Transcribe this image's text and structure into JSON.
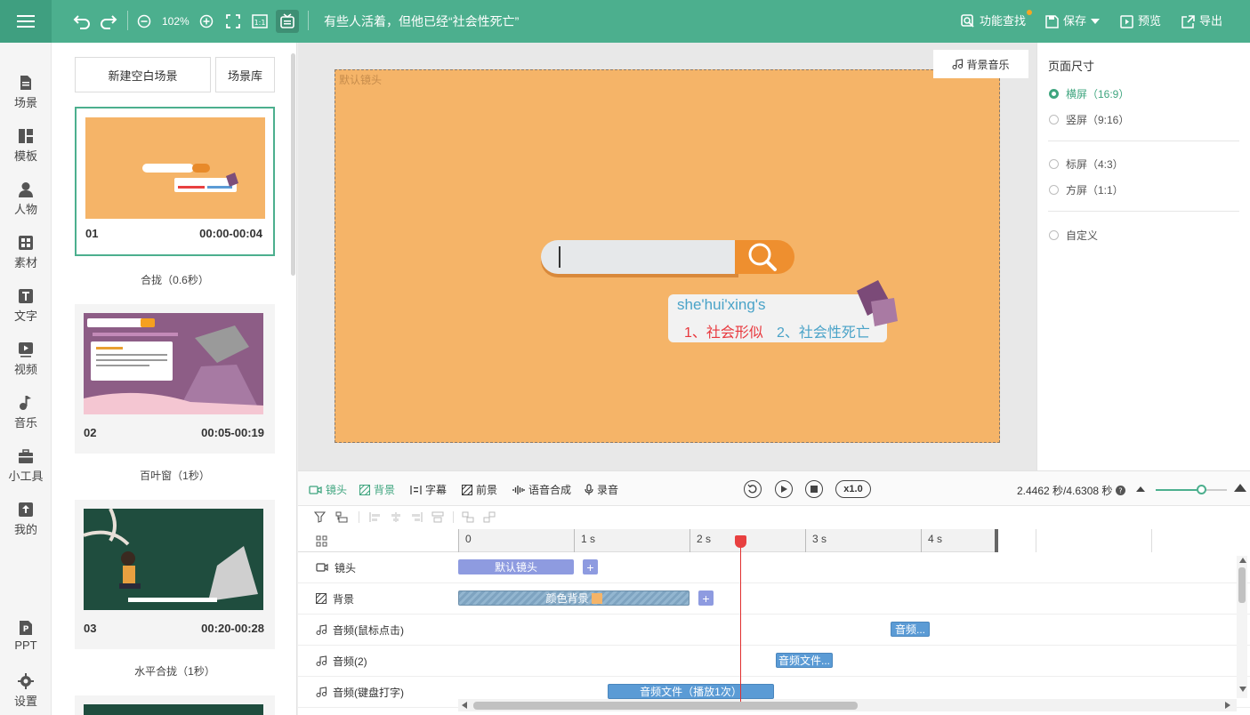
{
  "topbar": {
    "zoom": "102%",
    "title": "有些人活着，但他已经“社会性死亡”",
    "func_search": "功能查找",
    "save": "保存",
    "preview": "预览",
    "export": "导出"
  },
  "nav": [
    {
      "label": "场景",
      "icon": "scene-icon"
    },
    {
      "label": "模板",
      "icon": "template-icon"
    },
    {
      "label": "人物",
      "icon": "person-icon"
    },
    {
      "label": "素材",
      "icon": "material-icon"
    },
    {
      "label": "文字",
      "icon": "text-icon"
    },
    {
      "label": "视频",
      "icon": "video-icon"
    },
    {
      "label": "音乐",
      "icon": "music-icon"
    },
    {
      "label": "小工具",
      "icon": "toolbox-icon"
    },
    {
      "label": "我的",
      "icon": "upload-icon"
    },
    {
      "label": "PPT",
      "icon": "ppt-icon"
    },
    {
      "label": "设置",
      "icon": "gear-icon"
    }
  ],
  "scenes": {
    "new_blank": "新建空白场景",
    "library": "场景库",
    "items": [
      {
        "no": "01",
        "time": "00:00-00:04",
        "transition": "合拢（0.6秒）"
      },
      {
        "no": "02",
        "time": "00:05-00:19",
        "transition": "百叶窗（1秒）"
      },
      {
        "no": "03",
        "time": "00:20-00:28",
        "transition": "水平合拢（1秒）"
      }
    ]
  },
  "stage": {
    "label": "默认镜头",
    "bgm": "背景音乐",
    "pinyin": "she'hui'xing's",
    "suggest1": "1、社会形似",
    "suggest2": "2、社会性死亡"
  },
  "page_size": {
    "title": "页面尺寸",
    "options": [
      "横屏（16:9）",
      "竖屏（9:16）",
      "标屏（4:3）",
      "方屏（1:1）",
      "自定义"
    ],
    "selected": 0
  },
  "timeline": {
    "tabs": [
      "镜头",
      "背景",
      "字幕",
      "前景",
      "语音合成",
      "录音"
    ],
    "speed": "x1.0",
    "time": "2.4462 秒/4.6308 秒",
    "ticks": [
      "0",
      "1 s",
      "2 s",
      "3 s",
      "4 s"
    ],
    "tracks": [
      "镜头",
      "背景",
      "音频(鼠标点击)",
      "音频(2)",
      "音频(键盘打字)"
    ],
    "clips": {
      "camera": "默认镜头",
      "background": "颜色背景",
      "click_audio": "音频...",
      "audio2": "音频文件...",
      "typing_audio": "音频文件（播放1次）"
    }
  },
  "colors": {
    "accent": "#4caf8e",
    "stage": "#f5b468",
    "camera_clip": "#8e9be0",
    "audio_clip": "#5b9bd5"
  }
}
